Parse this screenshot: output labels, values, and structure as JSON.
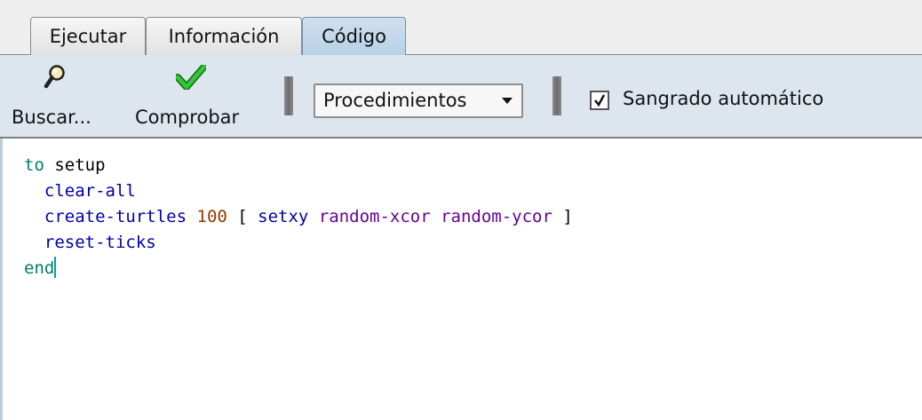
{
  "tabs": [
    {
      "label": "Ejecutar",
      "active": false
    },
    {
      "label": "Información",
      "active": false
    },
    {
      "label": "Código",
      "active": true
    }
  ],
  "toolbar": {
    "find_label": "Buscar...",
    "find_icon": "magnifier-icon",
    "check_label": "Comprobar",
    "check_icon": "green-checkmark-icon",
    "procedures_dropdown": "Procedimientos",
    "auto_indent_label": "Sangrado automático",
    "auto_indent_checked": true
  },
  "code": {
    "line1": {
      "kw": "to",
      "name": " setup"
    },
    "line2": {
      "cmd": "clear-all"
    },
    "line3": {
      "cmd": "create-turtles",
      "num": "100",
      "open": " [ ",
      "cmd2": "setxy",
      "rep1": "random-xcor",
      "rep2": "random-ycor",
      "close": " ]"
    },
    "line4": {
      "cmd": "reset-ticks"
    },
    "line5": {
      "kw": "end"
    }
  },
  "colors": {
    "keyword": "#007f69",
    "command": "#0000aa",
    "number": "#963700",
    "reporter": "#660096",
    "active_tab": "#b8d0e6",
    "toolbar_bg": "#dde6ef"
  }
}
